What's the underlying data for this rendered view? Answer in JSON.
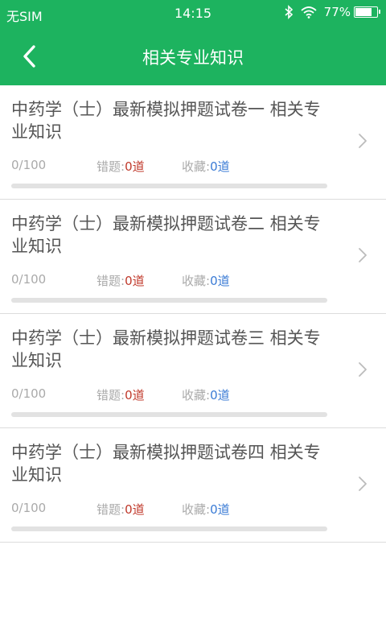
{
  "status_bar": {
    "carrier": "无SIM",
    "time": "14:15",
    "battery_text": "77%",
    "battery_level": 0.77
  },
  "header": {
    "title": "相关专业知识",
    "back_icon": "chevron-left-icon"
  },
  "colors": {
    "primary": "#1db35f",
    "wrong": "#c0392b",
    "favorite": "#3a7bd5"
  },
  "items": [
    {
      "title": "中药学（士）最新模拟押题试卷一 相关专业知识",
      "progress": "0/100",
      "progress_ratio": 0,
      "wrong_label": "错题:",
      "wrong_value": "0道",
      "fav_label": "收藏:",
      "fav_value": "0道"
    },
    {
      "title": "中药学（士）最新模拟押题试卷二 相关专业知识",
      "progress": "0/100",
      "progress_ratio": 0,
      "wrong_label": "错题:",
      "wrong_value": "0道",
      "fav_label": "收藏:",
      "fav_value": "0道"
    },
    {
      "title": "中药学（士）最新模拟押题试卷三 相关专业知识",
      "progress": "0/100",
      "progress_ratio": 0,
      "wrong_label": "错题:",
      "wrong_value": "0道",
      "fav_label": "收藏:",
      "fav_value": "0道"
    },
    {
      "title": "中药学（士）最新模拟押题试卷四 相关专业知识",
      "progress": "0/100",
      "progress_ratio": 0,
      "wrong_label": "错题:",
      "wrong_value": "0道",
      "fav_label": "收藏:",
      "fav_value": "0道"
    }
  ]
}
